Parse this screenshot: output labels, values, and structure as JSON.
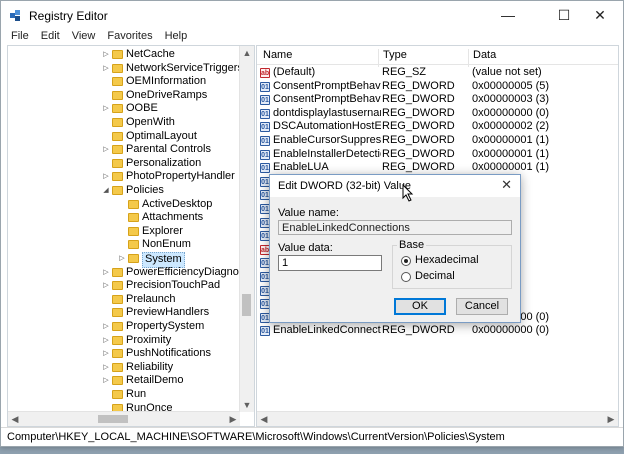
{
  "window": {
    "title": "Registry Editor",
    "minimize_glyph": "—",
    "maximize_glyph": "☐",
    "close_glyph": "✕"
  },
  "menu": [
    "File",
    "Edit",
    "View",
    "Favorites",
    "Help"
  ],
  "tree": {
    "items": [
      {
        "label": "NetCache",
        "expander": "▷",
        "level": 0
      },
      {
        "label": "NetworkServiceTriggers",
        "expander": "▷",
        "level": 0
      },
      {
        "label": "OEMInformation",
        "expander": "",
        "level": 0
      },
      {
        "label": "OneDriveRamps",
        "expander": "",
        "level": 0
      },
      {
        "label": "OOBE",
        "expander": "▷",
        "level": 0
      },
      {
        "label": "OpenWith",
        "expander": "",
        "level": 0
      },
      {
        "label": "OptimalLayout",
        "expander": "",
        "level": 0
      },
      {
        "label": "Parental Controls",
        "expander": "▷",
        "level": 0
      },
      {
        "label": "Personalization",
        "expander": "",
        "level": 0
      },
      {
        "label": "PhotoPropertyHandler",
        "expander": "▷",
        "level": 0
      },
      {
        "label": "Policies",
        "expander": "◢",
        "level": 0
      },
      {
        "label": "ActiveDesktop",
        "expander": "",
        "level": 1
      },
      {
        "label": "Attachments",
        "expander": "",
        "level": 1
      },
      {
        "label": "Explorer",
        "expander": "",
        "level": 1
      },
      {
        "label": "NonEnum",
        "expander": "",
        "level": 1
      },
      {
        "label": "System",
        "expander": "▷",
        "level": 1,
        "selected": true
      },
      {
        "label": "PowerEfficiencyDiagnostics",
        "expander": "▷",
        "level": 0
      },
      {
        "label": "PrecisionTouchPad",
        "expander": "▷",
        "level": 0
      },
      {
        "label": "Prelaunch",
        "expander": "",
        "level": 0
      },
      {
        "label": "PreviewHandlers",
        "expander": "",
        "level": 0
      },
      {
        "label": "PropertySystem",
        "expander": "▷",
        "level": 0
      },
      {
        "label": "Proximity",
        "expander": "▷",
        "level": 0
      },
      {
        "label": "PushNotifications",
        "expander": "▷",
        "level": 0
      },
      {
        "label": "Reliability",
        "expander": "▷",
        "level": 0
      },
      {
        "label": "RetailDemo",
        "expander": "▷",
        "level": 0
      },
      {
        "label": "Run",
        "expander": "",
        "level": 0
      },
      {
        "label": "RunOnce",
        "expander": "",
        "level": 0
      }
    ]
  },
  "values": {
    "columns": {
      "name": "Name",
      "type": "Type",
      "data": "Data"
    },
    "rows": [
      {
        "icon": "sz",
        "name": "(Default)",
        "type": "REG_SZ",
        "data": "(value not set)"
      },
      {
        "icon": "dw",
        "name": "ConsentPromptBehavio...",
        "type": "REG_DWORD",
        "data": "0x00000005 (5)"
      },
      {
        "icon": "dw",
        "name": "ConsentPromptBehavio...",
        "type": "REG_DWORD",
        "data": "0x00000003 (3)"
      },
      {
        "icon": "dw",
        "name": "dontdisplaylastusername",
        "type": "REG_DWORD",
        "data": "0x00000000 (0)"
      },
      {
        "icon": "dw",
        "name": "DSCAutomationHostEn...",
        "type": "REG_DWORD",
        "data": "0x00000002 (2)"
      },
      {
        "icon": "dw",
        "name": "EnableCursorSuppression",
        "type": "REG_DWORD",
        "data": "0x00000001 (1)"
      },
      {
        "icon": "dw",
        "name": "EnableInstallerDetection",
        "type": "REG_DWORD",
        "data": "0x00000001 (1)"
      },
      {
        "icon": "dw",
        "name": "EnableLUA",
        "type": "REG_DWORD",
        "data": "0x00000001 (1)"
      },
      {
        "icon": "dw",
        "name": "",
        "type": "",
        "data": "(1)"
      },
      {
        "icon": "dw",
        "name": "",
        "type": "",
        "data": "(0)"
      },
      {
        "icon": "dw",
        "name": "",
        "type": "",
        "data": "(1)"
      },
      {
        "icon": "dw",
        "name": "",
        "type": "",
        "data": ""
      },
      {
        "icon": "dw",
        "name": "",
        "type": "",
        "data": ""
      },
      {
        "icon": "sz",
        "name": "",
        "type": "",
        "data": ""
      },
      {
        "icon": "dw",
        "name": "",
        "type": "",
        "data": "(1)"
      },
      {
        "icon": "dw",
        "name": "",
        "type": "",
        "data": "(0)"
      },
      {
        "icon": "dw",
        "name": "",
        "type": "",
        "data": "(1)"
      },
      {
        "icon": "dw",
        "name": "",
        "type": "",
        "data": "(1)"
      },
      {
        "icon": "dw",
        "name": "ValidateAdminCodeSig...",
        "type": "REG_DWORD",
        "data": "0x00000000 (0)"
      },
      {
        "icon": "dw",
        "name": "EnableLinkedConnectio...",
        "type": "REG_DWORD",
        "data": "0x00000000 (0)"
      }
    ]
  },
  "dialog": {
    "title": "Edit DWORD (32-bit) Value",
    "close_glyph": "✕",
    "value_name_label": "Value name:",
    "value_name": "EnableLinkedConnections",
    "value_data_label": "Value data:",
    "value_data": "1",
    "base_label": "Base",
    "hex_label": "Hexadecimal",
    "dec_label": "Decimal",
    "ok_label": "OK",
    "cancel_label": "Cancel"
  },
  "status": {
    "path": "Computer\\HKEY_LOCAL_MACHINE\\SOFTWARE\\Microsoft\\Windows\\CurrentVersion\\Policies\\System"
  },
  "colors": {
    "folder": "#f4c94a",
    "selection": "#cce8ff",
    "accent": "#0078d7"
  }
}
